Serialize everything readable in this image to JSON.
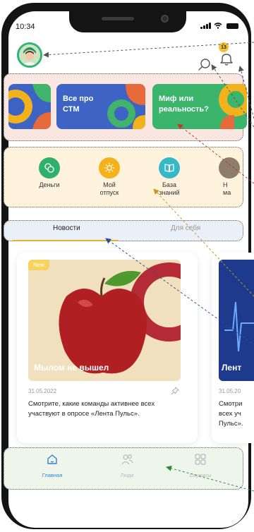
{
  "status_bar": {
    "time": "10:34"
  },
  "header": {
    "notifications_count": "13"
  },
  "banners": [
    {
      "text": "Все про\nСТМ",
      "color": "#3d64c4"
    },
    {
      "text": "Миф или\nреальность?",
      "color": "#3bb56b"
    }
  ],
  "quick_actions": [
    {
      "label": "Деньги",
      "icon": "wallet-icon",
      "color": "#2fb16d"
    },
    {
      "label": "Мой\nотпуск",
      "icon": "sun-icon",
      "color": "#f3b21c"
    },
    {
      "label": "База\nзнаний",
      "icon": "book-icon",
      "color": "#36b8c6"
    },
    {
      "label": "Н\nма",
      "icon": "item-icon",
      "color": "#8d7d6a"
    }
  ],
  "tabs": [
    {
      "label": "Новости",
      "active": true
    },
    {
      "label": "Для себя",
      "active": false
    }
  ],
  "cards": [
    {
      "badge": "New",
      "title": "Мылом не вышел",
      "date": "31.05.2022",
      "text": "Смотрите, какие команды активнее всех участвуют в опросе «Лента Пульс»."
    },
    {
      "title": "Лент",
      "date": "31.05.20",
      "text": "Смотри всех уч Пульс»."
    }
  ],
  "bottom_nav": [
    {
      "label": "Главная",
      "icon": "home-icon",
      "active": true
    },
    {
      "label": "Люди",
      "icon": "people-icon",
      "active": false
    },
    {
      "label": "Сервисы",
      "icon": "grid-icon",
      "active": false
    }
  ],
  "colors": {
    "accent_green": "#2fb673",
    "accent_yellow": "#e8b032",
    "nav_active": "#2e7fd8",
    "nav_inactive": "#b9b9b9"
  }
}
